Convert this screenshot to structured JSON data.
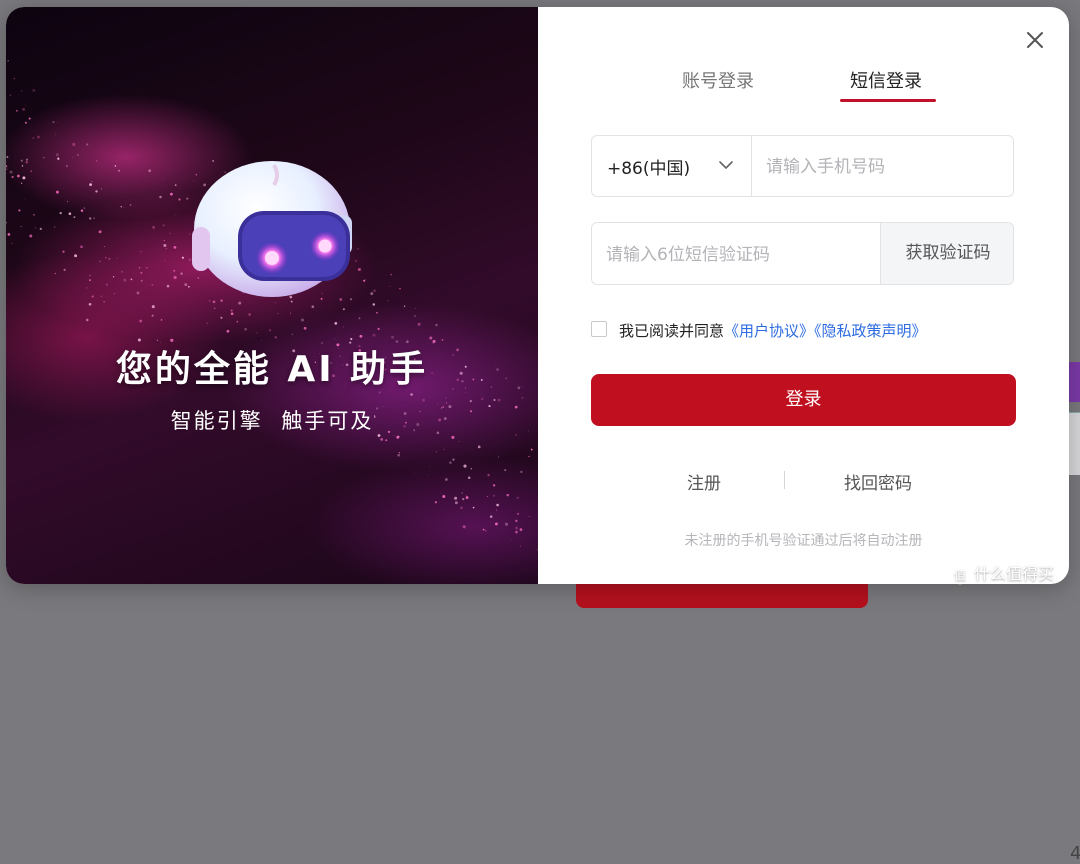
{
  "hero": {
    "title": "您的全能 AI 助手",
    "subtitle": "智能引擎  触手可及"
  },
  "tabs": {
    "account_login": "账号登录",
    "sms_login": "短信登录",
    "active": "sms_login"
  },
  "phone": {
    "country_code": "+86(中国)",
    "placeholder": "请输入手机号码",
    "value": ""
  },
  "code": {
    "placeholder": "请输入6位短信验证码",
    "value": "",
    "get_code_label": "获取验证码"
  },
  "agreement": {
    "checked": false,
    "text": "我已阅读并同意",
    "user_agreement": "《用户协议》",
    "privacy_policy": "《隐私政策声明》"
  },
  "actions": {
    "login_label": "登录",
    "register_label": "注册",
    "forgot_password_label": "找回密码"
  },
  "footnote": "未注册的手机号验证通过后将自动注册",
  "watermark": {
    "text": "什么值得买"
  },
  "background": {
    "peek_digit": "4"
  },
  "colors": {
    "accent": "#c0101f",
    "link": "#2d6be0",
    "tab_underline": "#c0102a"
  }
}
